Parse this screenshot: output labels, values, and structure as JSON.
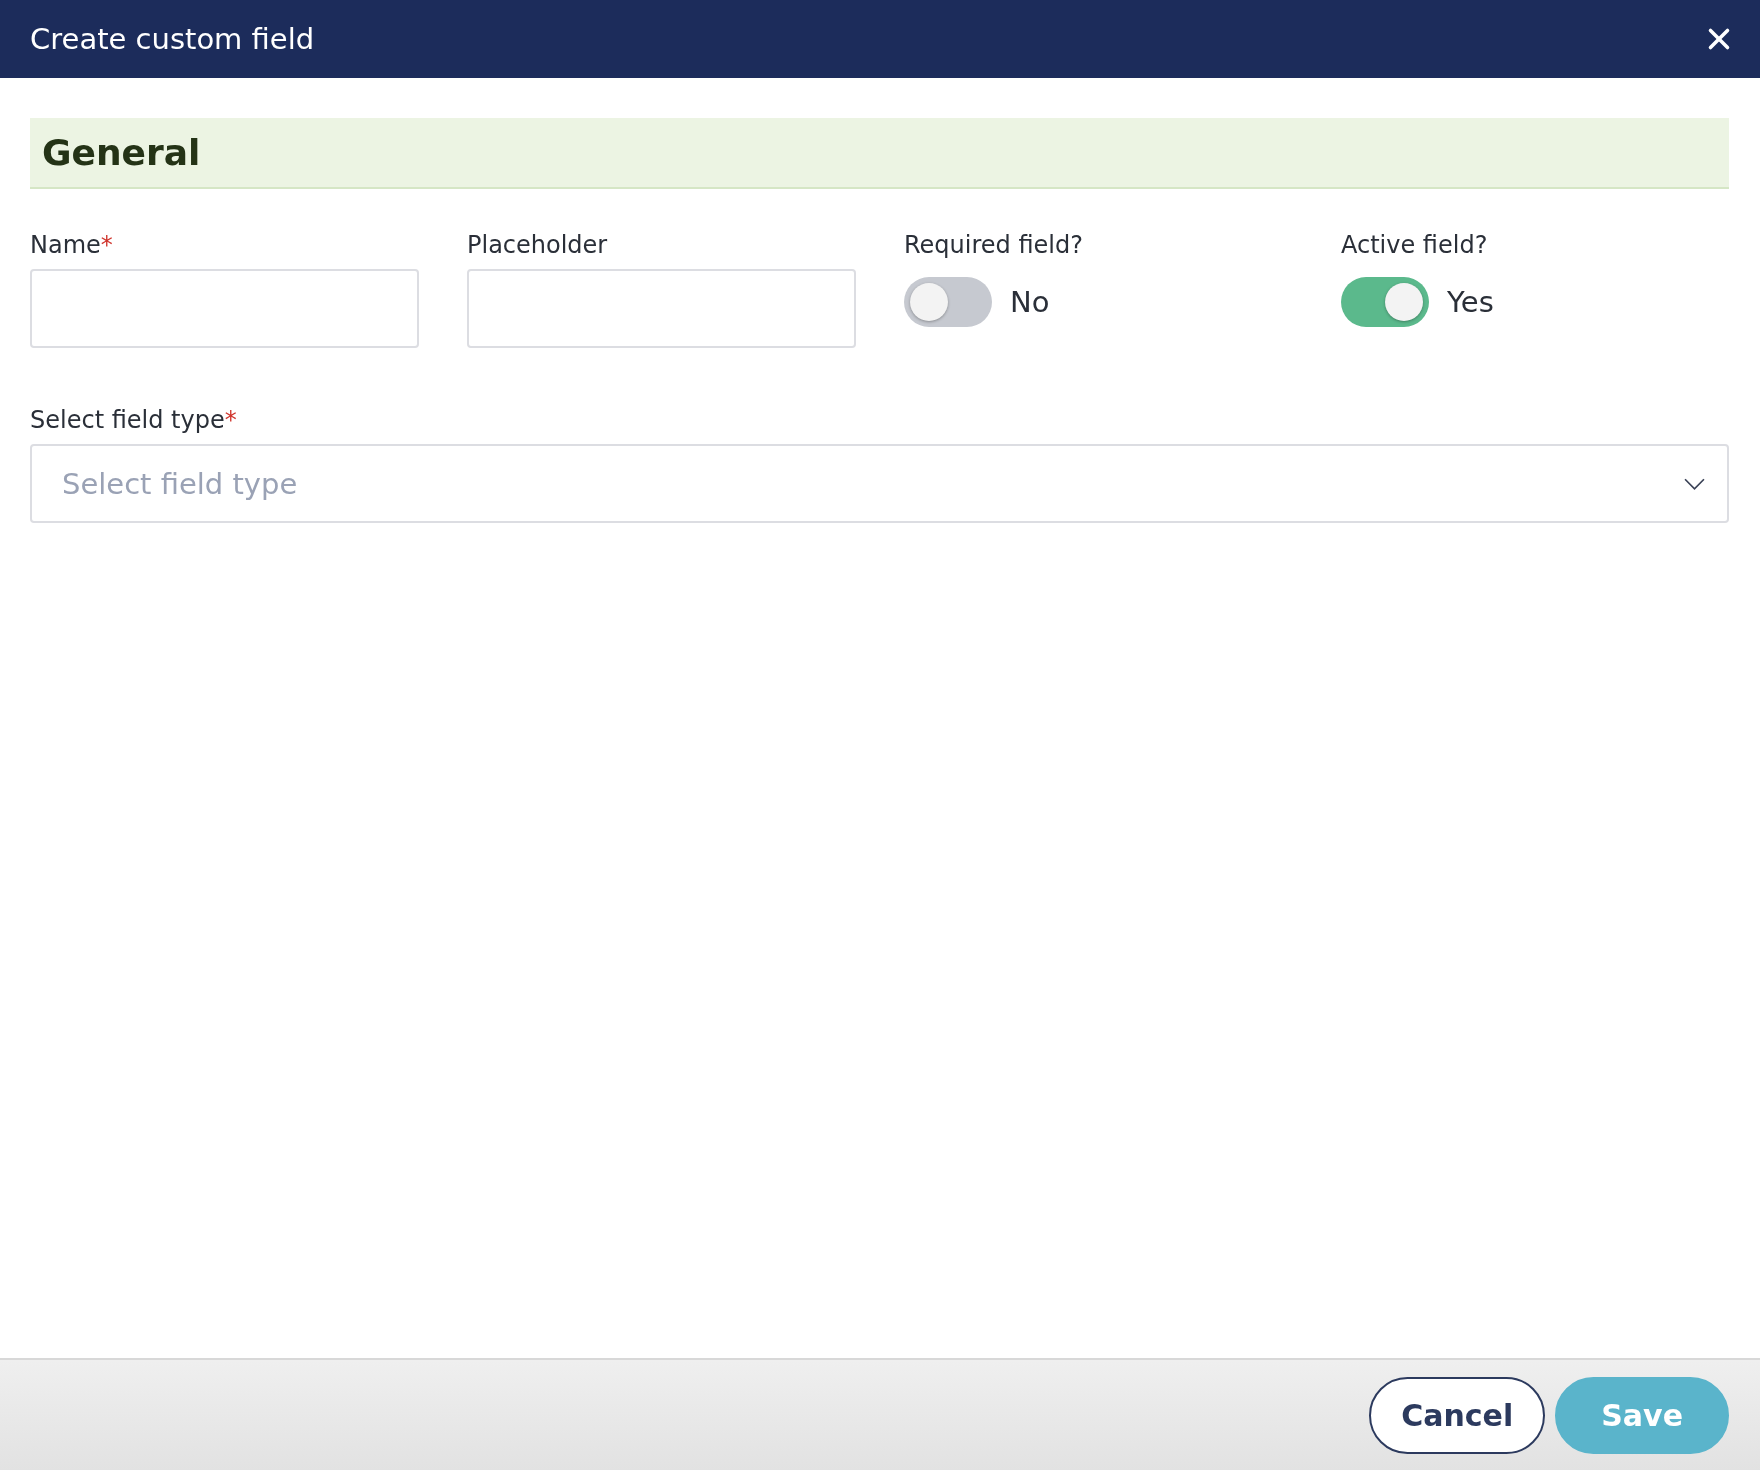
{
  "dialog": {
    "title": "Create custom field"
  },
  "section": {
    "title": "General"
  },
  "fields": [
    {
      "kind": "text",
      "label": "Name",
      "mark": "*"
    },
    {
      "kind": "text",
      "label": "Placeholder"
    },
    {
      "kind": "toggle",
      "label": "Required field?",
      "on": false,
      "value": "No"
    },
    {
      "kind": "toggle",
      "label": "Active field?",
      "on": true,
      "value": "Yes"
    }
  ],
  "select": {
    "label": "Select field type",
    "mark": "*",
    "placeholder": "Select field type"
  },
  "buttons": [
    {
      "kind": "secondary",
      "label": "Cancel"
    },
    {
      "kind": "primary",
      "label": "Save"
    }
  ]
}
